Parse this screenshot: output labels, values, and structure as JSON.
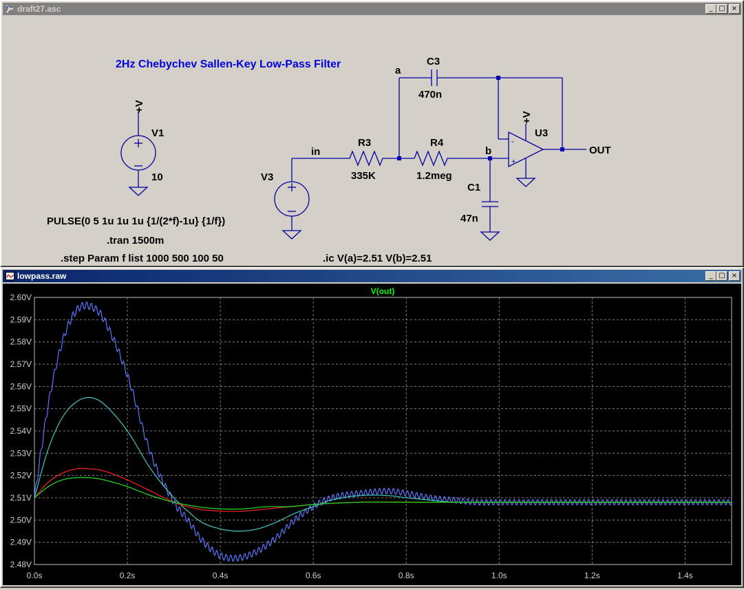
{
  "schematic_window": {
    "title": "draft27.asc",
    "controls": {
      "minimize": "_",
      "maximize": "□",
      "close": "×"
    }
  },
  "schematic": {
    "title": "2Hz Chebychev Sallen-Key Low-Pass Filter",
    "supply_label": "+V",
    "opamp_supply_label": "+V",
    "V1": {
      "name": "V1",
      "value": "10"
    },
    "V3": {
      "name": "V3",
      "value": "PULSE(0 5 1u 1u 1u {1/(2*f)-1u} {1/f})"
    },
    "R3": {
      "name": "R3",
      "value": "335K"
    },
    "R4": {
      "name": "R4",
      "value": "1.2meg"
    },
    "C3": {
      "name": "C3",
      "value": "470n"
    },
    "C1": {
      "name": "C1",
      "value": "47n"
    },
    "U3": {
      "name": "U3"
    },
    "nets": {
      "in": "in",
      "a": "a",
      "b": "b",
      "out": "OUT"
    },
    "opamp_minus": "-",
    "opamp_plus": "+",
    "directives": {
      "tran": ".tran 1500m",
      "step": ".step Param f list 1000 500 100 50",
      "ic": ".ic V(a)=2.51 V(b)=2.51"
    }
  },
  "plot_window": {
    "title": "lowpass.raw",
    "controls": {
      "minimize": "_",
      "maximize": "□",
      "close": "×"
    }
  },
  "chart_data": {
    "type": "line",
    "title": "V(out)",
    "title_color": "#00ff00",
    "xlabel": "",
    "ylabel": "",
    "xlim": [
      0,
      1.5
    ],
    "ylim": [
      2.48,
      2.6
    ],
    "x_ticks": [
      {
        "v": 0.0,
        "label": "0.0s"
      },
      {
        "v": 0.2,
        "label": "0.2s"
      },
      {
        "v": 0.4,
        "label": "0.4s"
      },
      {
        "v": 0.6,
        "label": "0.6s"
      },
      {
        "v": 0.8,
        "label": "0.8s"
      },
      {
        "v": 1.0,
        "label": "1.0s"
      },
      {
        "v": 1.2,
        "label": "1.2s"
      },
      {
        "v": 1.4,
        "label": "1.4s"
      }
    ],
    "y_ticks": [
      {
        "v": 2.6,
        "label": "2.60V"
      },
      {
        "v": 2.59,
        "label": "2.59V"
      },
      {
        "v": 2.58,
        "label": "2.58V"
      },
      {
        "v": 2.57,
        "label": "2.57V"
      },
      {
        "v": 2.56,
        "label": "2.56V"
      },
      {
        "v": 2.55,
        "label": "2.55V"
      },
      {
        "v": 2.54,
        "label": "2.54V"
      },
      {
        "v": 2.53,
        "label": "2.53V"
      },
      {
        "v": 2.52,
        "label": "2.52V"
      },
      {
        "v": 2.51,
        "label": "2.51V"
      },
      {
        "v": 2.5,
        "label": "2.50V"
      },
      {
        "v": 2.49,
        "label": "2.49V"
      },
      {
        "v": 2.48,
        "label": "2.48V"
      }
    ],
    "grid": true,
    "series": [
      {
        "color": "#5a78ff",
        "ripple": true,
        "x": [
          0,
          0.03,
          0.06,
          0.09,
          0.12,
          0.15,
          0.2,
          0.25,
          0.3,
          0.33,
          0.36,
          0.4,
          0.44,
          0.48,
          0.52,
          0.56,
          0.6,
          0.64,
          0.7,
          0.76,
          0.8,
          0.85,
          0.9,
          0.95,
          1.0,
          1.1,
          1.2,
          1.3,
          1.4,
          1.5
        ],
        "y": [
          2.51,
          2.552,
          2.58,
          2.594,
          2.596,
          2.59,
          2.565,
          2.53,
          2.508,
          2.5,
          2.491,
          2.484,
          2.483,
          2.486,
          2.492,
          2.5,
          2.506,
          2.51,
          2.512,
          2.513,
          2.512,
          2.51,
          2.509,
          2.508,
          2.508,
          2.508,
          2.508,
          2.508,
          2.508,
          2.508
        ]
      },
      {
        "color": "#40c8c8",
        "ripple": false,
        "x": [
          0,
          0.03,
          0.06,
          0.09,
          0.12,
          0.15,
          0.2,
          0.25,
          0.3,
          0.33,
          0.36,
          0.4,
          0.44,
          0.48,
          0.52,
          0.56,
          0.6,
          0.64,
          0.7,
          0.76,
          0.8,
          0.85,
          0.9,
          0.95,
          1.0,
          1.1,
          1.2,
          1.3,
          1.4,
          1.5
        ],
        "y": [
          2.51,
          2.532,
          2.546,
          2.553,
          2.555,
          2.552,
          2.54,
          2.523,
          2.51,
          2.504,
          2.499,
          2.496,
          2.495,
          2.496,
          2.499,
          2.503,
          2.506,
          2.509,
          2.511,
          2.511,
          2.51,
          2.509,
          2.508,
          2.508,
          2.508,
          2.508,
          2.508,
          2.508,
          2.508,
          2.508
        ]
      },
      {
        "color": "#ff2020",
        "ripple": false,
        "x": [
          0,
          0.03,
          0.06,
          0.09,
          0.12,
          0.15,
          0.2,
          0.25,
          0.3,
          0.35,
          0.4,
          0.45,
          0.5,
          0.55,
          0.6,
          0.7,
          0.8,
          0.9,
          1.0,
          1.1,
          1.2,
          1.3,
          1.4,
          1.5
        ],
        "y": [
          2.51,
          2.517,
          2.521,
          2.523,
          2.523,
          2.522,
          2.518,
          2.513,
          2.508,
          2.505,
          2.504,
          2.504,
          2.505,
          2.506,
          2.507,
          2.508,
          2.508,
          2.508,
          2.508,
          2.508,
          2.508,
          2.508,
          2.508,
          2.508
        ]
      },
      {
        "color": "#20e020",
        "ripple": false,
        "x": [
          0,
          0.03,
          0.06,
          0.09,
          0.12,
          0.15,
          0.2,
          0.25,
          0.3,
          0.35,
          0.4,
          0.45,
          0.5,
          0.55,
          0.6,
          0.7,
          0.8,
          0.9,
          1.0,
          1.1,
          1.2,
          1.3,
          1.4,
          1.5
        ],
        "y": [
          2.51,
          2.515,
          2.518,
          2.519,
          2.519,
          2.518,
          2.515,
          2.511,
          2.508,
          2.506,
          2.505,
          2.505,
          2.506,
          2.506,
          2.507,
          2.508,
          2.508,
          2.508,
          2.508,
          2.508,
          2.508,
          2.508,
          2.508,
          2.508
        ]
      }
    ]
  }
}
